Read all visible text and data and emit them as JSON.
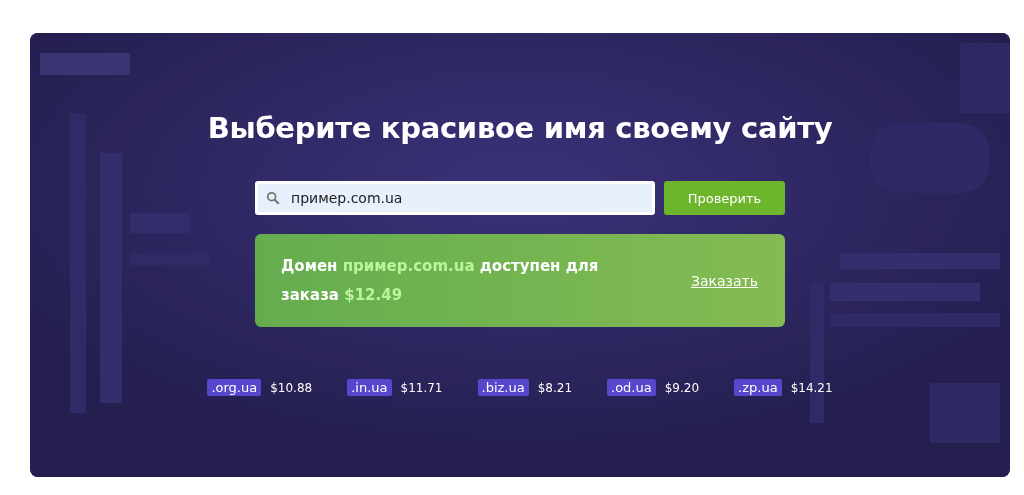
{
  "heading": "Выберите красивое имя своему сайту",
  "search": {
    "value": "пример.com.ua",
    "button": "Проверить"
  },
  "result": {
    "lead": "Домен",
    "domain": "пример.com.ua",
    "middle": "доступен для заказа",
    "price": "$12.49",
    "link": "Заказать"
  },
  "zones": [
    {
      "zone": ".org.ua",
      "price": "$10.88"
    },
    {
      "zone": ".in.ua",
      "price": "$11.71"
    },
    {
      "zone": ".biz.ua",
      "price": "$8.21"
    },
    {
      "zone": ".od.ua",
      "price": "$9.20"
    },
    {
      "zone": ".zp.ua",
      "price": "$14.21"
    }
  ]
}
